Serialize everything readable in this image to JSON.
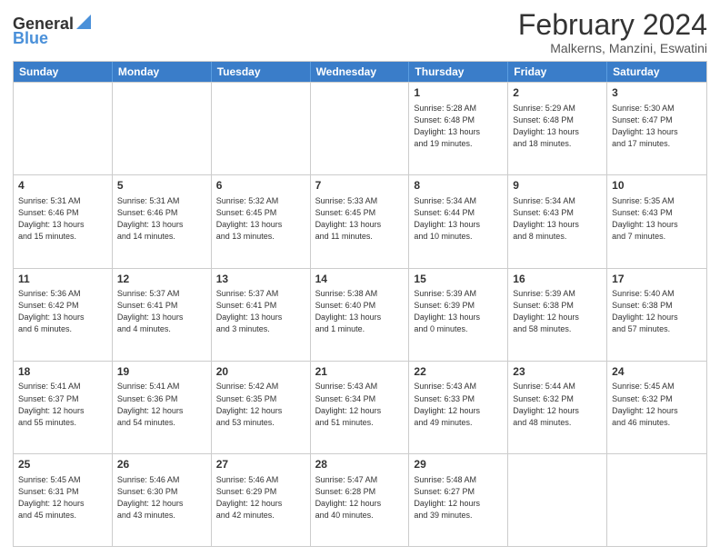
{
  "header": {
    "logo_general": "General",
    "logo_blue": "Blue",
    "month_year": "February 2024",
    "location": "Malkerns, Manzini, Eswatini"
  },
  "weekdays": [
    "Sunday",
    "Monday",
    "Tuesday",
    "Wednesday",
    "Thursday",
    "Friday",
    "Saturday"
  ],
  "weeks": [
    [
      {
        "day": "",
        "info": ""
      },
      {
        "day": "",
        "info": ""
      },
      {
        "day": "",
        "info": ""
      },
      {
        "day": "",
        "info": ""
      },
      {
        "day": "1",
        "info": "Sunrise: 5:28 AM\nSunset: 6:48 PM\nDaylight: 13 hours\nand 19 minutes."
      },
      {
        "day": "2",
        "info": "Sunrise: 5:29 AM\nSunset: 6:48 PM\nDaylight: 13 hours\nand 18 minutes."
      },
      {
        "day": "3",
        "info": "Sunrise: 5:30 AM\nSunset: 6:47 PM\nDaylight: 13 hours\nand 17 minutes."
      }
    ],
    [
      {
        "day": "4",
        "info": "Sunrise: 5:31 AM\nSunset: 6:46 PM\nDaylight: 13 hours\nand 15 minutes."
      },
      {
        "day": "5",
        "info": "Sunrise: 5:31 AM\nSunset: 6:46 PM\nDaylight: 13 hours\nand 14 minutes."
      },
      {
        "day": "6",
        "info": "Sunrise: 5:32 AM\nSunset: 6:45 PM\nDaylight: 13 hours\nand 13 minutes."
      },
      {
        "day": "7",
        "info": "Sunrise: 5:33 AM\nSunset: 6:45 PM\nDaylight: 13 hours\nand 11 minutes."
      },
      {
        "day": "8",
        "info": "Sunrise: 5:34 AM\nSunset: 6:44 PM\nDaylight: 13 hours\nand 10 minutes."
      },
      {
        "day": "9",
        "info": "Sunrise: 5:34 AM\nSunset: 6:43 PM\nDaylight: 13 hours\nand 8 minutes."
      },
      {
        "day": "10",
        "info": "Sunrise: 5:35 AM\nSunset: 6:43 PM\nDaylight: 13 hours\nand 7 minutes."
      }
    ],
    [
      {
        "day": "11",
        "info": "Sunrise: 5:36 AM\nSunset: 6:42 PM\nDaylight: 13 hours\nand 6 minutes."
      },
      {
        "day": "12",
        "info": "Sunrise: 5:37 AM\nSunset: 6:41 PM\nDaylight: 13 hours\nand 4 minutes."
      },
      {
        "day": "13",
        "info": "Sunrise: 5:37 AM\nSunset: 6:41 PM\nDaylight: 13 hours\nand 3 minutes."
      },
      {
        "day": "14",
        "info": "Sunrise: 5:38 AM\nSunset: 6:40 PM\nDaylight: 13 hours\nand 1 minute."
      },
      {
        "day": "15",
        "info": "Sunrise: 5:39 AM\nSunset: 6:39 PM\nDaylight: 13 hours\nand 0 minutes."
      },
      {
        "day": "16",
        "info": "Sunrise: 5:39 AM\nSunset: 6:38 PM\nDaylight: 12 hours\nand 58 minutes."
      },
      {
        "day": "17",
        "info": "Sunrise: 5:40 AM\nSunset: 6:38 PM\nDaylight: 12 hours\nand 57 minutes."
      }
    ],
    [
      {
        "day": "18",
        "info": "Sunrise: 5:41 AM\nSunset: 6:37 PM\nDaylight: 12 hours\nand 55 minutes."
      },
      {
        "day": "19",
        "info": "Sunrise: 5:41 AM\nSunset: 6:36 PM\nDaylight: 12 hours\nand 54 minutes."
      },
      {
        "day": "20",
        "info": "Sunrise: 5:42 AM\nSunset: 6:35 PM\nDaylight: 12 hours\nand 53 minutes."
      },
      {
        "day": "21",
        "info": "Sunrise: 5:43 AM\nSunset: 6:34 PM\nDaylight: 12 hours\nand 51 minutes."
      },
      {
        "day": "22",
        "info": "Sunrise: 5:43 AM\nSunset: 6:33 PM\nDaylight: 12 hours\nand 49 minutes."
      },
      {
        "day": "23",
        "info": "Sunrise: 5:44 AM\nSunset: 6:32 PM\nDaylight: 12 hours\nand 48 minutes."
      },
      {
        "day": "24",
        "info": "Sunrise: 5:45 AM\nSunset: 6:32 PM\nDaylight: 12 hours\nand 46 minutes."
      }
    ],
    [
      {
        "day": "25",
        "info": "Sunrise: 5:45 AM\nSunset: 6:31 PM\nDaylight: 12 hours\nand 45 minutes."
      },
      {
        "day": "26",
        "info": "Sunrise: 5:46 AM\nSunset: 6:30 PM\nDaylight: 12 hours\nand 43 minutes."
      },
      {
        "day": "27",
        "info": "Sunrise: 5:46 AM\nSunset: 6:29 PM\nDaylight: 12 hours\nand 42 minutes."
      },
      {
        "day": "28",
        "info": "Sunrise: 5:47 AM\nSunset: 6:28 PM\nDaylight: 12 hours\nand 40 minutes."
      },
      {
        "day": "29",
        "info": "Sunrise: 5:48 AM\nSunset: 6:27 PM\nDaylight: 12 hours\nand 39 minutes."
      },
      {
        "day": "",
        "info": ""
      },
      {
        "day": "",
        "info": ""
      }
    ]
  ]
}
